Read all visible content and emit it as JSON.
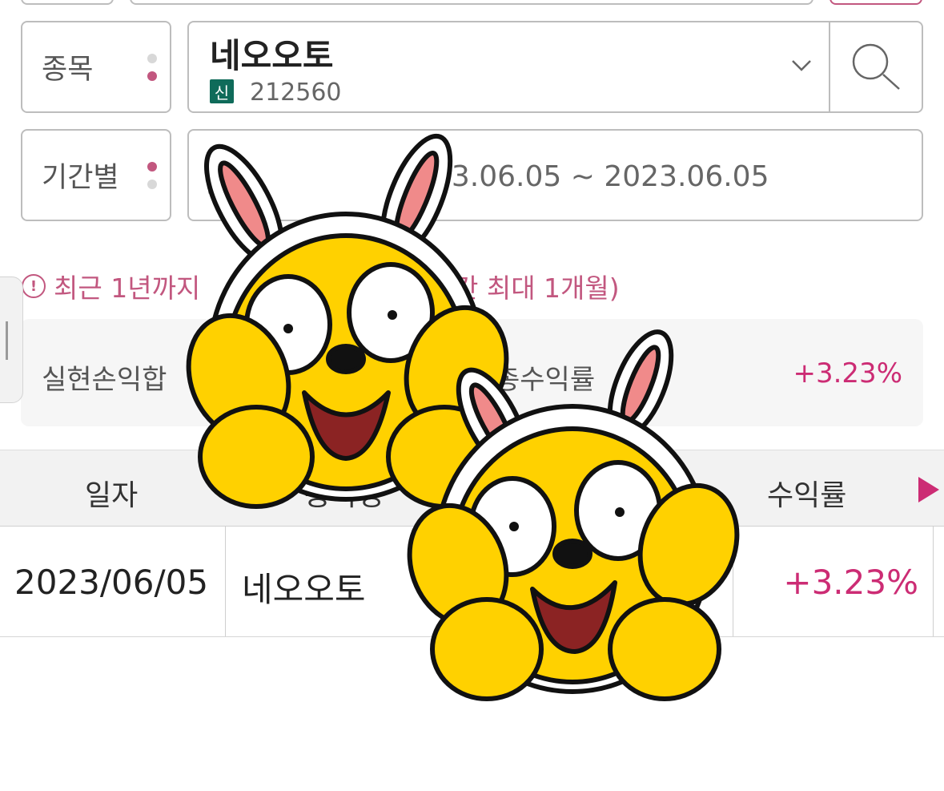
{
  "stock": {
    "label": "종목",
    "name": "네오오토",
    "badge": "신",
    "code": "212560"
  },
  "period": {
    "label": "기간별",
    "range": "23.06.05 ~ 2023.06.05"
  },
  "notice": {
    "icon": "!",
    "text_left": "최근 1년까지",
    "text_right": "간 최대 1개월)"
  },
  "summary": {
    "realized_label": "실현손익합",
    "total_return_label": "총수익률",
    "total_return_value": "+3.23%"
  },
  "table": {
    "headers": [
      "일자",
      "종목명",
      "수익률"
    ],
    "rows": [
      {
        "date": "2023/06/05",
        "name": "네오오토",
        "partial": "0",
        "return": "+3.23%"
      }
    ]
  },
  "colors": {
    "accent": "#c2577f",
    "positive": "#cc2c74",
    "badge_bg": "#0f6b5a"
  },
  "icons": {
    "search": "search-icon",
    "dropdown": "chevron-down-icon",
    "next": "caret-right-icon",
    "calendar": "calendar-icon",
    "info": "info-circle-icon"
  }
}
